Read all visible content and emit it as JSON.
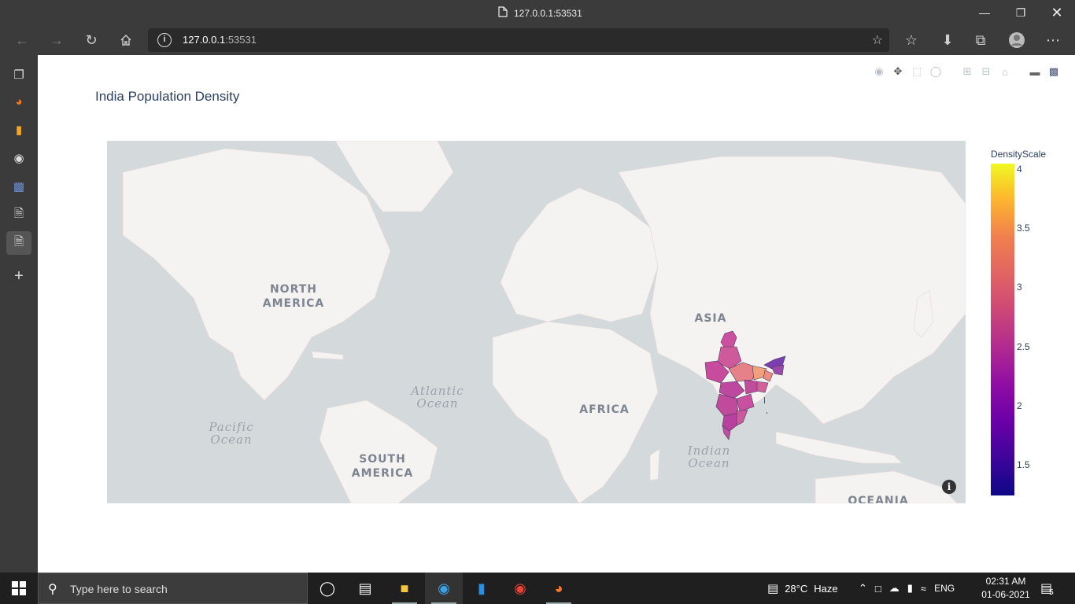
{
  "window": {
    "title": "127.0.0.1:53531"
  },
  "address_bar": {
    "host": "127.0.0.1",
    "port": ":53531"
  },
  "plot": {
    "title": "India Population Density"
  },
  "map_labels": {
    "north_america": "NORTH AMERICA",
    "south_america": "SOUTH AMERICA",
    "africa": "AFRICA",
    "asia": "ASIA",
    "oceania": "OCEANIA",
    "atlantic": "Atlantic Ocean",
    "pacific": "Pacific Ocean",
    "indian": "Indian Ocean"
  },
  "chart_data": {
    "type": "choropleth",
    "colorbar": {
      "title": "DensityScale",
      "ticks": [
        "4",
        "3.5",
        "3",
        "2.5",
        "2",
        "1.5"
      ],
      "range": [
        1.25,
        4.05
      ],
      "colorscale": "plasma"
    }
  },
  "taskbar": {
    "search_placeholder": "Type here to search",
    "weather": "28°C",
    "weather_desc": "Haze",
    "language": "ENG",
    "time": "02:31 AM",
    "date": "01-06-2021",
    "notification_count": "5"
  },
  "colors": {
    "chrome_dark": "#3b3b3b",
    "map_water": "#d4d9dc",
    "map_land": "#f4f3f1"
  }
}
